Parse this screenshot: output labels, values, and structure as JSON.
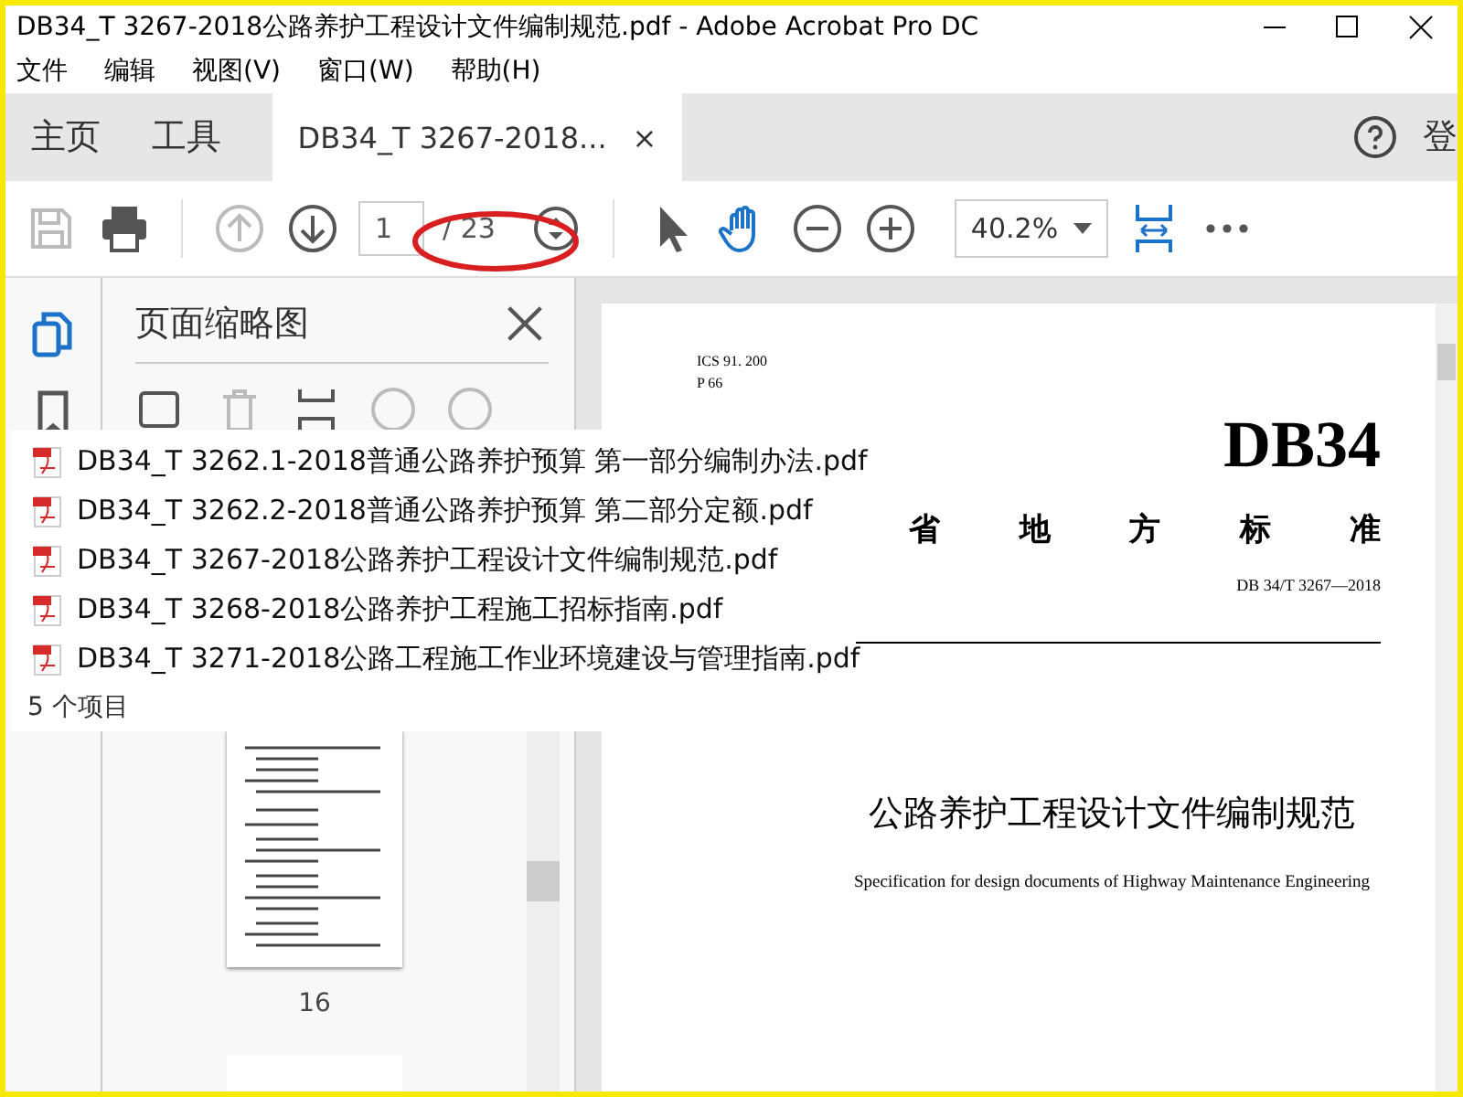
{
  "window": {
    "title": "DB34_T 3267-2018公路养护工程设计文件编制规范.pdf - Adobe Acrobat Pro DC"
  },
  "menu": [
    "文件",
    "编辑",
    "视图(V)",
    "窗口(W)",
    "帮助(H)"
  ],
  "nav_tabs": [
    {
      "label": "主页",
      "selected": false
    },
    {
      "label": "工具",
      "selected": false
    }
  ],
  "doc_tab": {
    "label": "DB34_T 3267-2018...",
    "close": "×",
    "selected": true
  },
  "signin": "登",
  "toolbar": {
    "page_value": "1",
    "page_total": "/ 23",
    "zoom": "40.2%"
  },
  "sidebar": {
    "title": "页面缩略图",
    "thumbnail_label": "16"
  },
  "file_list": {
    "items": [
      "DB34_T 3262.1-2018普通公路养护预算 第一部分编制办法.pdf",
      "DB34_T 3262.2-2018普通公路养护预算 第二部分定额.pdf",
      "DB34_T 3267-2018公路养护工程设计文件编制规范.pdf",
      "DB34_T 3268-2018公路养护工程施工招标指南.pdf",
      "DB34_T 3271-2018公路工程施工作业环境建设与管理指南.pdf"
    ],
    "count": "5 个项目"
  },
  "document": {
    "ics": "ICS 91. 200",
    "class_code": "P 66",
    "code": "DB34",
    "category_chars": [
      "省",
      "地",
      "方",
      "标",
      "准"
    ],
    "number": "DB 34/T 3267—2018",
    "title": "公路养护工程设计文件编制规范",
    "subtitle": "Specification for design documents of Highway Maintenance Engineering"
  }
}
